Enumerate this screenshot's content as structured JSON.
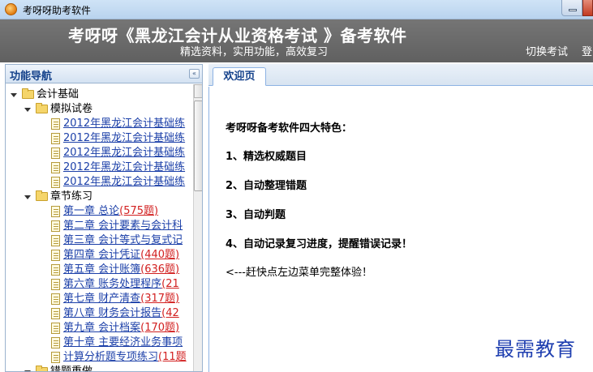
{
  "window": {
    "title": "考呀呀助考软件"
  },
  "banner": {
    "title": "考呀呀《黑龙江会计从业资格考试 》备考软件",
    "subtitle": "精选资料，实用功能，高效复习",
    "switch_exam": "切换考试",
    "login": "登"
  },
  "nav": {
    "title": "功能导航",
    "collapse_icon": "«",
    "root": "会计基础",
    "mock_folder": "模拟试卷",
    "mock_items": [
      "2012年黑龙江会计基础练",
      "2012年黑龙江会计基础练",
      "2012年黑龙江会计基础练",
      "2012年黑龙江会计基础练",
      "2012年黑龙江会计基础练"
    ],
    "chapter_folder": "章节练习",
    "chapters": [
      {
        "text": "第一章 总论",
        "count": "(575题)"
      },
      {
        "text": "第二章 会计要素与会计科",
        "count": ""
      },
      {
        "text": "第三章 会计等式与复式记",
        "count": ""
      },
      {
        "text": "第四章 会计凭证",
        "count": "(440题)"
      },
      {
        "text": "第五章 会计账簿",
        "count": "(636题)"
      },
      {
        "text": "第六章 账务处理程序",
        "count": "(21"
      },
      {
        "text": "第七章 财产清查",
        "count": "(317题)"
      },
      {
        "text": "第八章 财务会计报告",
        "count": "(42"
      },
      {
        "text": "第九章 会计档案",
        "count": "(170题)"
      },
      {
        "text": "第十章 主要经济业务事项",
        "count": ""
      },
      {
        "text": "计算分析题专项练习",
        "count": "(11题"
      }
    ],
    "errors_folder": "错题重做"
  },
  "tabs": {
    "welcome": "欢迎页"
  },
  "content": {
    "heading": "考呀呀备考软件四大特色：",
    "features": [
      "1、精选权威题目",
      "2、自动整理错题",
      "3、自动判题",
      "4、自动记录复习进度，提醒错误记录！"
    ],
    "note": "<---赶快点左边菜单完整体验！"
  },
  "watermark": "最需教育"
}
